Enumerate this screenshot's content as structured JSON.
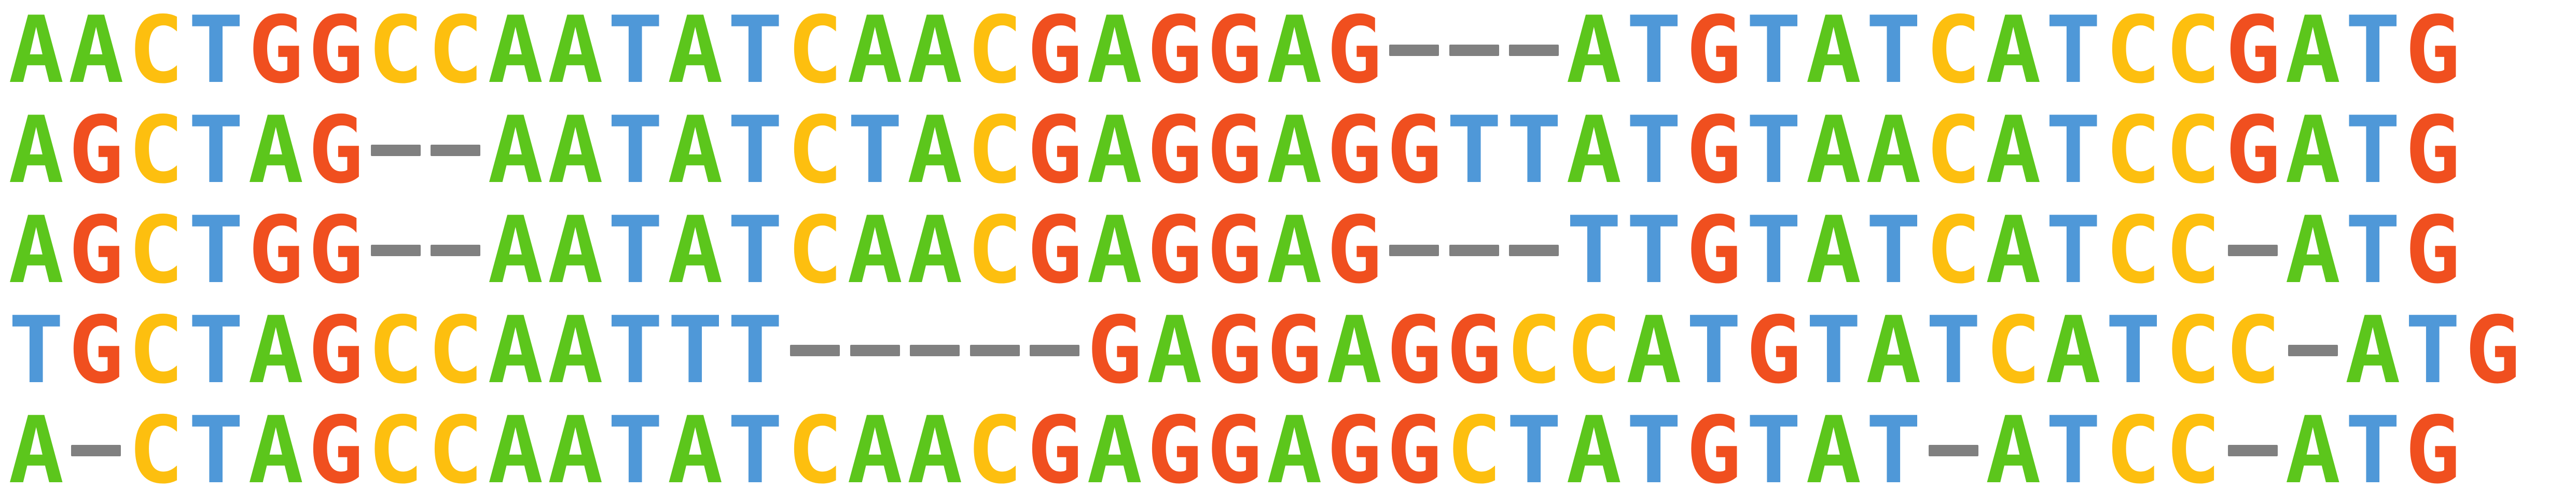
{
  "alignment": {
    "rows": [
      "AACTGGCCAATATCAACGAGGAG---ATGTATCATCCGATG",
      "AGCTAG--AATATCTACGAGGAGGTTATGTAACATCCGATG",
      "AGCTGG--AATATCAACGAGGAG---TTGTATCATCC-ATG",
      "TGCTAGCCAATTT-----GAGGAGGCCATGTATCATCC-ATG",
      "A-CTAGCCAATATCAACGAGGAGGCTATGTAT-ATCC-ATG"
    ]
  },
  "colors": {
    "A": "#5cc61c",
    "C": "#fdbf0f",
    "G": "#f04f1f",
    "T": "#4f98d8",
    "-": "#808080"
  }
}
